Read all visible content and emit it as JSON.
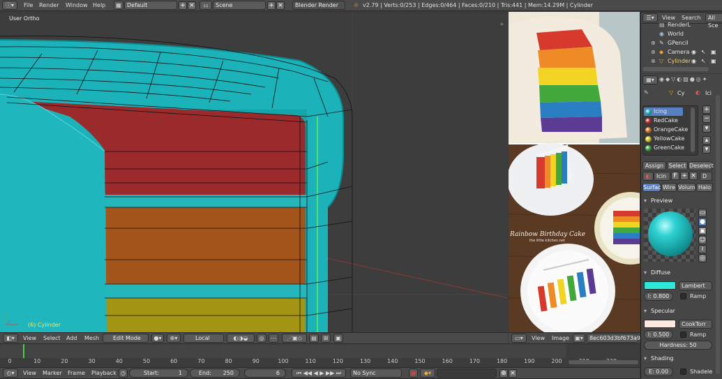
{
  "menu": {
    "items": [
      "File",
      "Render",
      "Window",
      "Help"
    ],
    "layout": "Default",
    "scene": "Scene",
    "engine": "Blender Render",
    "stats": "v2.79 | Verts:0/253 | Edges:0/464 | Faces:0/210 | Tris:441 | Mem:14.29M | Cylinder"
  },
  "viewport": {
    "view_label": "User Ortho",
    "object_label": "(6) Cylinder"
  },
  "viewport_header": {
    "view": "View",
    "select": "Select",
    "add": "Add",
    "mesh": "Mesh",
    "mode": "Edit Mode",
    "orientation": "Local"
  },
  "image_editor": {
    "view": "View",
    "image": "Image",
    "image_name": "8ec603d3bf673a9...",
    "cake_caption": "Rainbow Birthday Cake",
    "cake_subcaption": "the little kitchen.net"
  },
  "timeline": {
    "ruler": [
      "0",
      "10",
      "20",
      "30",
      "40",
      "50",
      "60",
      "70",
      "80",
      "90",
      "100",
      "110",
      "120",
      "130",
      "140",
      "150",
      "160",
      "170",
      "180",
      "190",
      "200",
      "210",
      "220"
    ],
    "view": "View",
    "marker": "Marker",
    "frame": "Frame",
    "playback": "Playback",
    "start_label": "Start:",
    "start_value": "1",
    "end_label": "End:",
    "end_value": "250",
    "current_frame": "6",
    "sync": "No Sync"
  },
  "outliner": {
    "view": "View",
    "search": "Search",
    "all_scenes": "All Sce",
    "items": [
      "RenderL",
      "World",
      "GPencil",
      "Camera",
      "Cylinder"
    ]
  },
  "properties": {
    "breadcrumb_object": "Cy",
    "breadcrumb_material": "Ici",
    "materials": [
      {
        "name": "Icing",
        "color": "#22b5b5"
      },
      {
        "name": "RedCake",
        "color": "#c0272d"
      },
      {
        "name": "OrangeCake",
        "color": "#d9731f"
      },
      {
        "name": "YellowCake",
        "color": "#d9c21f"
      },
      {
        "name": "GreenCake",
        "color": "#3aa83a"
      }
    ],
    "assign": "Assign",
    "select": "Select",
    "deselect": "Deselect",
    "material_name": "Icin",
    "fake_user": "F",
    "data_link": "D",
    "tabs": [
      "Surfac",
      "Wire",
      "Volum",
      "Halo"
    ],
    "preview_title": "Preview",
    "diffuse_title": "Diffuse",
    "diffuse_color": "#2ee6d9",
    "diffuse_shader": "Lambert",
    "intensity": "I: 0.800",
    "ramp": "Ramp",
    "specular_title": "Specular",
    "specular_color": "#fde8e0",
    "specular_shader": "CookTorr",
    "spec_intensity": "I: 0.500",
    "hardness": "Hardness: 50",
    "shading_title": "Shading",
    "emit": "E: 0.00",
    "shadeless": "Shadele"
  },
  "colors": {
    "icing": "#1bb3b9",
    "red_layer": "#9a2a2c",
    "orange_layer": "#a3541a",
    "yellow_layer": "#a39413",
    "selection_blue": "#5680c2"
  }
}
